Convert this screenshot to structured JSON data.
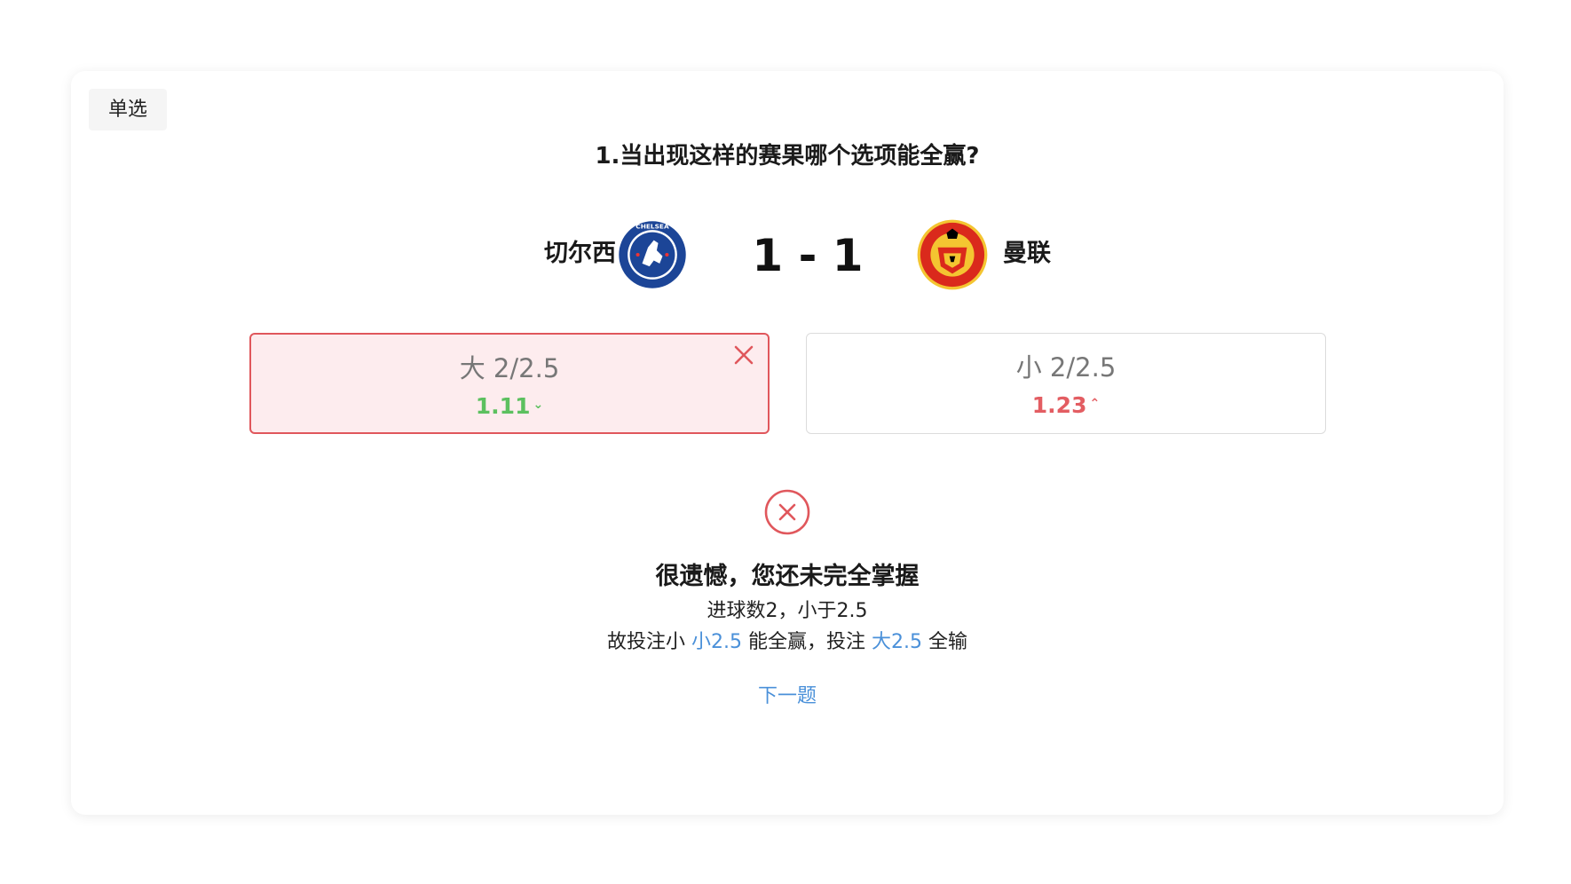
{
  "tag": "单选",
  "question": "1.当出现这样的赛果哪个选项能全赢?",
  "match": {
    "home": {
      "name": "切尔西",
      "crest": "chelsea-crest-icon"
    },
    "away": {
      "name": "曼联",
      "crest": "manutd-crest-icon"
    },
    "score": "1 - 1"
  },
  "options": [
    {
      "label": "大 2/2.5",
      "odds": "1.11",
      "trend": "down",
      "trend_glyph": "⌄",
      "state": "wrong"
    },
    {
      "label": "小 2/2.5",
      "odds": "1.23",
      "trend": "up",
      "trend_glyph": "⌃",
      "state": "default"
    }
  ],
  "result": {
    "icon": "wrong-circle-icon",
    "title": "很遗憾，您还未完全掌握",
    "line1": "进球数2，小于2.5",
    "line2_prefix": "故投注小 ",
    "line2_hl1": "小2.5",
    "line2_mid": " 能全赢，投注 ",
    "line2_hl2": "大2.5",
    "line2_suffix": " 全输"
  },
  "next_label": "下一题",
  "colors": {
    "wrong_red": "#e0575c",
    "wrong_bg": "#fdecee",
    "odds_down": "#5cc05f",
    "odds_up": "#e35d62",
    "link_blue": "#4a90d9"
  }
}
